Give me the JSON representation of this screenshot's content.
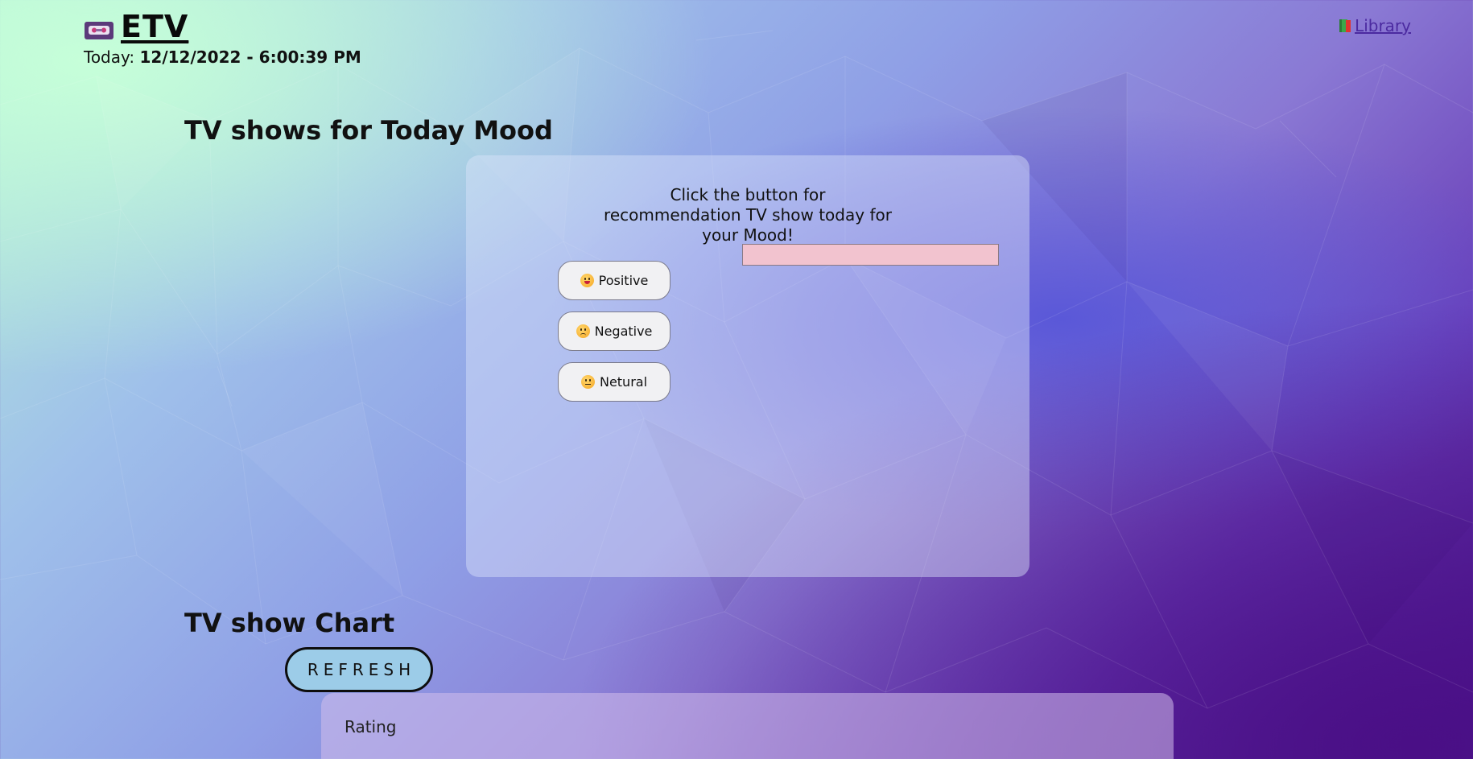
{
  "header": {
    "logo_text": "ETV",
    "logo_icon": "vhs-cassette-icon",
    "today_label": "Today:",
    "today_value": "12/12/2022 - 6:00:39 PM",
    "library_label": "Library",
    "library_icon": "book-icon"
  },
  "mood_section": {
    "title": "TV shows for Today Mood",
    "instruction": "Click the button for recommendation TV show today for your Mood!",
    "buttons": [
      {
        "label": "Positive",
        "icon": "grinning-face-icon"
      },
      {
        "label": "Negative",
        "icon": "worried-face-icon"
      },
      {
        "label": "Netural",
        "icon": "neutral-face-icon"
      }
    ],
    "result_value": ""
  },
  "chart_section": {
    "title": "TV show Chart",
    "refresh_label": "REFRESH",
    "rating_label": "Rating"
  },
  "colors": {
    "result_box": "#f2c3cf",
    "refresh_button": "#9ccce8",
    "library_link": "#4b2aa0"
  }
}
